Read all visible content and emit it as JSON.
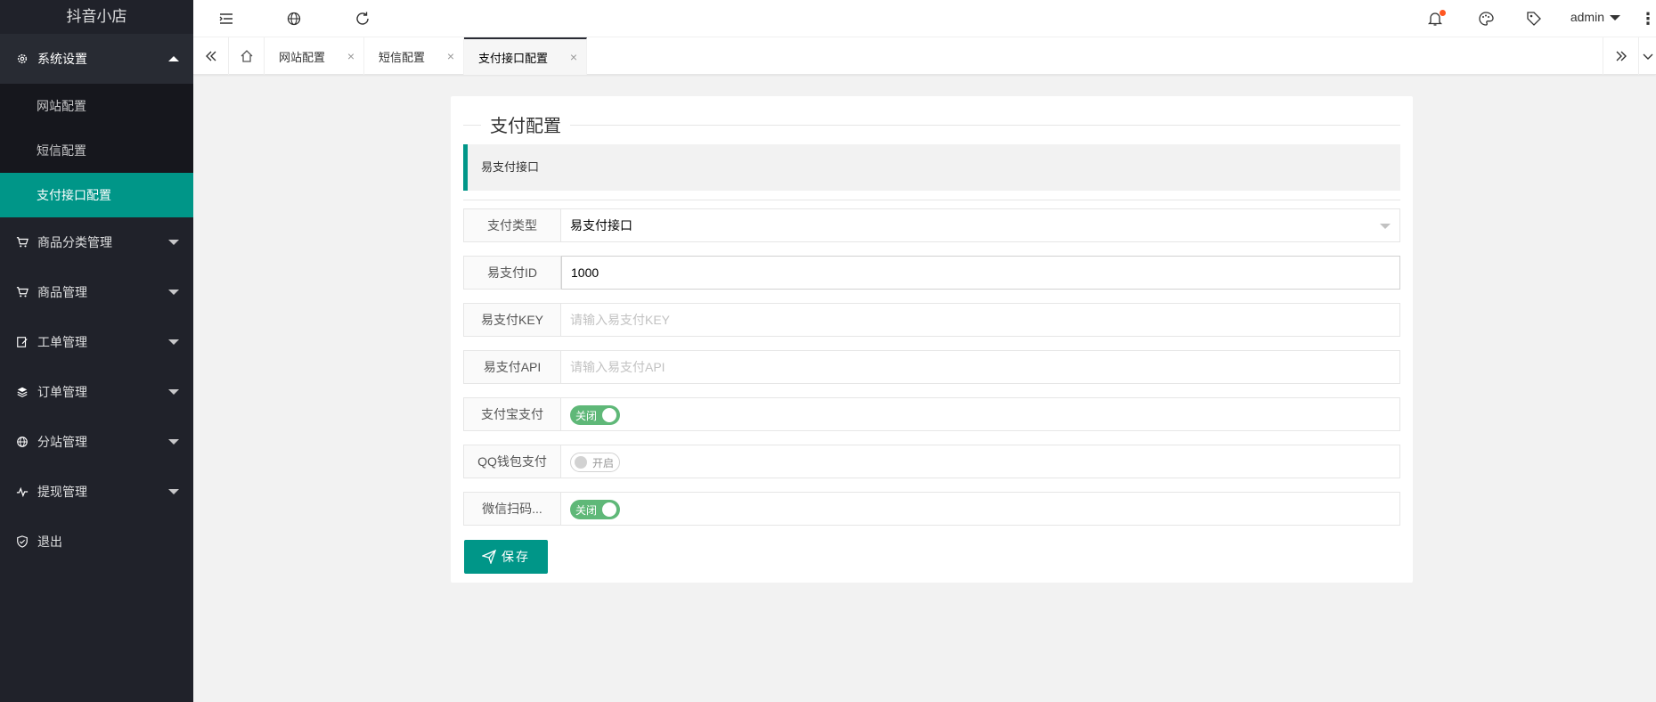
{
  "app": {
    "title": "抖音小店"
  },
  "sidebar": {
    "system_settings": "系统设置",
    "sub_items": [
      "网站配置",
      "短信配置",
      "支付接口配置"
    ],
    "menus": [
      "商品分类管理",
      "商品管理",
      "工单管理",
      "订单管理",
      "分站管理",
      "提现管理",
      "退出"
    ]
  },
  "header": {
    "user": "admin"
  },
  "tabs": [
    {
      "label": "网站配置",
      "close": "×"
    },
    {
      "label": "短信配置",
      "close": "×"
    },
    {
      "label": "支付接口配置",
      "close": "×"
    }
  ],
  "form": {
    "legend": "支付配置",
    "quote": "易支付接口",
    "rows": [
      {
        "label": "支付类型",
        "value": "易支付接口"
      },
      {
        "label": "易支付ID",
        "value": "1000"
      },
      {
        "label": "易支付KEY",
        "placeholder": "请输入易支付KEY"
      },
      {
        "label": "易支付API",
        "placeholder": "请输入易支付API"
      },
      {
        "label": "支付宝支付",
        "switch_text": "关闭"
      },
      {
        "label": "QQ钱包支付",
        "switch_text": "开启"
      },
      {
        "label": "微信扫码...",
        "switch_text": "关闭"
      }
    ],
    "save_label": "保存"
  },
  "colors": {
    "accent": "#009688",
    "sidebar_bg": "#20222a",
    "switch_on": "#5fb878",
    "notify_dot": "#ff5722"
  }
}
